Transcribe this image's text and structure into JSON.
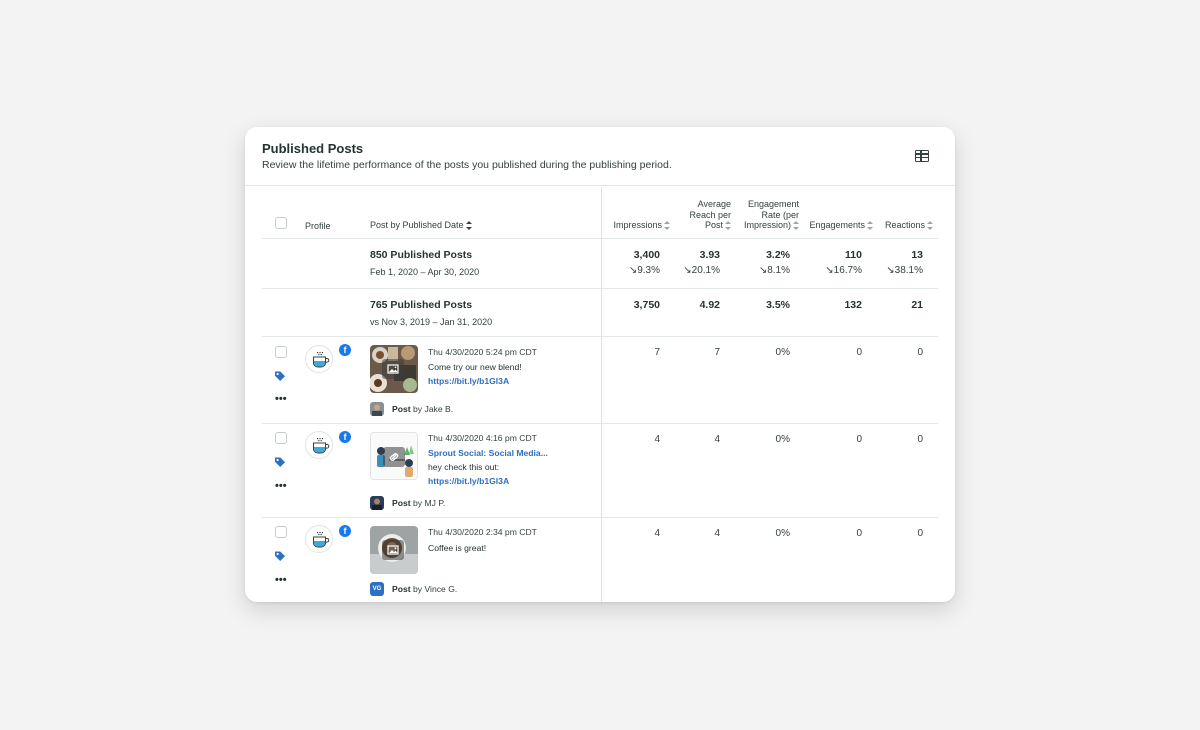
{
  "header": {
    "title": "Published Posts",
    "subtitle": "Review the lifetime performance of the posts you published during the publishing period.",
    "table_icon": "table-icon"
  },
  "columns": {
    "profile": "Profile",
    "post": "Post by Published Date",
    "impressions": "Impressions",
    "reach": [
      "Average",
      "Reach per",
      "Post"
    ],
    "engagement_rate": [
      "Engagement",
      "Rate (per",
      "Impression)"
    ],
    "engagements": "Engagements",
    "reactions": "Reactions"
  },
  "summary": [
    {
      "title": "850 Published Posts",
      "range": "Feb 1, 2020 – Apr 30, 2020",
      "impressions": "3,400",
      "reach": "3.93",
      "rate": "3.2%",
      "engagements": "110",
      "reactions": "13",
      "d_impressions": "↘9.3%",
      "d_reach": "↘20.1%",
      "d_rate": "↘8.1%",
      "d_engagements": "↘16.7%",
      "d_reactions": "↘38.1%"
    },
    {
      "title": "765 Published Posts",
      "range": "vs Nov 3, 2019 – Jan 31, 2020",
      "impressions": "3,750",
      "reach": "4.92",
      "rate": "3.5%",
      "engagements": "132",
      "reactions": "21"
    }
  ],
  "posts": [
    {
      "date": "Thu 4/30/2020 5:24 pm CDT",
      "line1": "Come try our new blend!",
      "link1": "https://bit.ly/b1Gl3A",
      "line2": "",
      "type": "Post",
      "by": "by Jake B.",
      "impressions": "7",
      "reach": "7",
      "rate": "0%",
      "engagements": "0",
      "reactions": "0"
    },
    {
      "date": "Thu 4/30/2020 4:16 pm CDT",
      "link0": "Sprout Social: Social Media...",
      "line1": "hey check this out:",
      "link1": "https://bit.ly/b1Gl3A",
      "type": "Post",
      "by": "by MJ P.",
      "impressions": "4",
      "reach": "4",
      "rate": "0%",
      "engagements": "0",
      "reactions": "0"
    },
    {
      "date": "Thu 4/30/2020 2:34 pm CDT",
      "line1": "Coffee is great!",
      "type": "Post",
      "by": "by Vince G.",
      "initials": "VG",
      "impressions": "4",
      "reach": "4",
      "rate": "0%",
      "engagements": "0",
      "reactions": "0"
    }
  ],
  "colors": {
    "link": "#2d6fc1",
    "tag": "#2d6fc1",
    "facebook": "#1877f2"
  },
  "icons": {
    "sort": "sort-icon",
    "tag": "tag-icon",
    "more": "more-dots-icon",
    "facebook": "facebook-icon",
    "image": "image-icon",
    "link": "link-icon"
  }
}
